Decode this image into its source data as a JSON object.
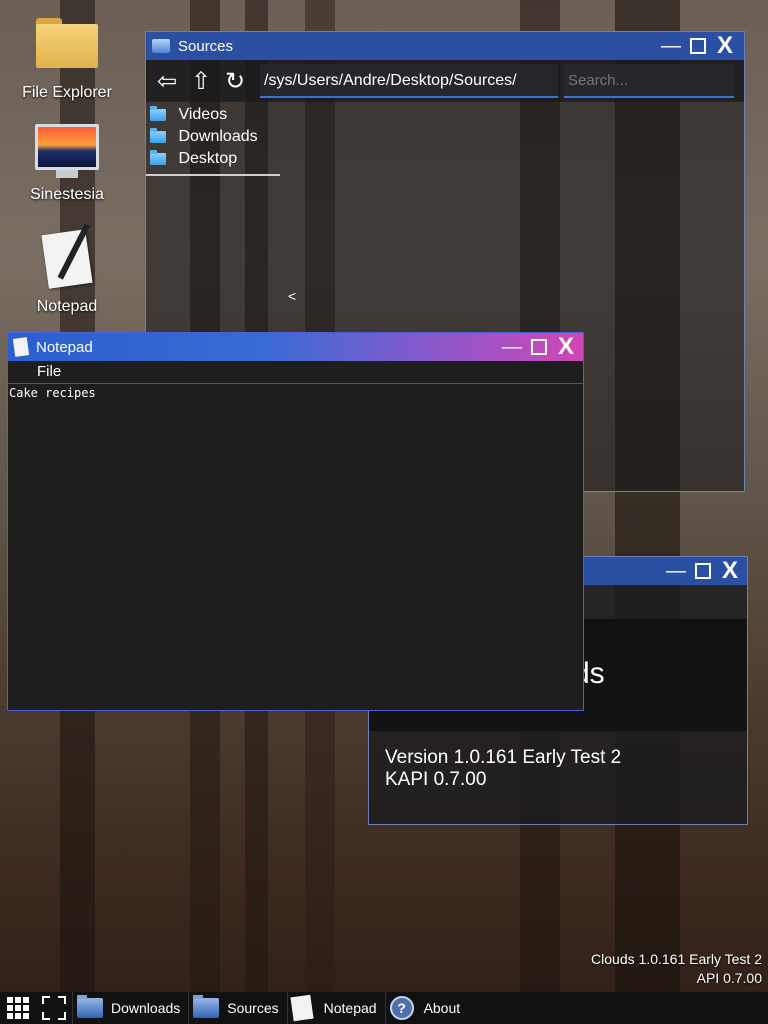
{
  "desktop": {
    "icons": [
      {
        "label": "File Explorer",
        "icon": "folder-icon"
      },
      {
        "label": "Sinestesia",
        "icon": "monitor-icon"
      },
      {
        "label": "Notepad",
        "icon": "notepad-icon"
      }
    ],
    "watermark": {
      "line1": "Clouds 1.0.161 Early Test 2",
      "line2": "API 0.7.00"
    }
  },
  "sources_window": {
    "title": "Sources",
    "controls": {
      "minimize": "—",
      "close": "X"
    },
    "nav": {
      "back_icon": "⇦",
      "up_icon": "⇧",
      "refresh_icon": "↻"
    },
    "path": "/sys/Users/Andre/Desktop/Sources/",
    "search_placeholder": "Search...",
    "items": [
      {
        "label": "Videos"
      },
      {
        "label": "Downloads"
      },
      {
        "label": "Desktop"
      }
    ],
    "collapse_arrow": "<"
  },
  "about_window": {
    "partial_title": "ds",
    "version": "Version 1.0.161 Early Test 2",
    "kapi": "KAPI 0.7.00",
    "controls": {
      "minimize": "—",
      "close": "X"
    }
  },
  "notepad_window": {
    "title": "Notepad",
    "menu_file": "File",
    "content": "Cake recipes",
    "controls": {
      "minimize": "—",
      "close": "X"
    }
  },
  "taskbar": {
    "items": [
      {
        "label": "Downloads",
        "icon": "folder-icon"
      },
      {
        "label": "Sources",
        "icon": "folder-icon"
      },
      {
        "label": "Notepad",
        "icon": "notepad-icon"
      },
      {
        "label": "About",
        "icon": "help-icon"
      }
    ]
  },
  "colors": {
    "titlebar_blue": "#2b4fa3",
    "notepad_gradient_start": "#2b5fcf",
    "notepad_gradient_end": "#d046b4",
    "window_dark": "#1e1e1e",
    "taskbar": "#111111"
  }
}
